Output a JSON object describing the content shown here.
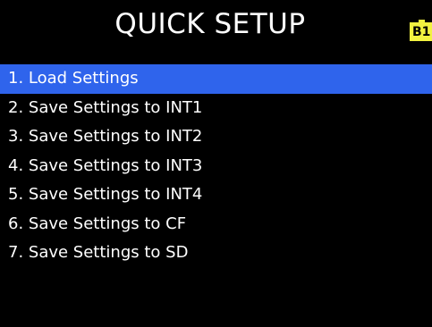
{
  "header": {
    "title": "QUICK SETUP",
    "badge": {
      "icon": "battery-icon",
      "label": "B1",
      "color": "#f2f240"
    }
  },
  "menu": {
    "selected_index": 0,
    "highlight_color": "#2f64ec",
    "items": [
      {
        "label": "1. Load Settings"
      },
      {
        "label": "2. Save Settings to INT1"
      },
      {
        "label": "3. Save Settings to INT2"
      },
      {
        "label": "4. Save Settings to INT3"
      },
      {
        "label": "5. Save Settings to INT4"
      },
      {
        "label": "6. Save Settings to CF"
      },
      {
        "label": "7. Save Settings to SD"
      }
    ]
  }
}
